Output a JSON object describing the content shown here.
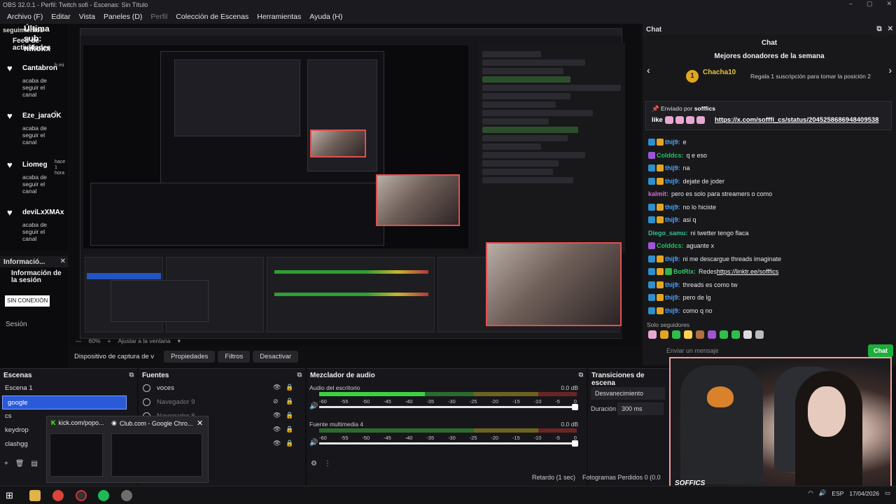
{
  "window": {
    "title": "OBS 32.0.1 - Perfil: Twitch sofi - Escenas: Sin Título"
  },
  "menu": [
    "Archivo (F)",
    "Editar",
    "Vista",
    "Paneles (D)",
    "Perfil",
    "Colección de Escenas",
    "Herramientas",
    "Ayuda (H)"
  ],
  "feed": {
    "ultima_sub": "Última sub: nikoxx",
    "seguimientos": "seguimientos",
    "title": "Feed de actividades",
    "items": [
      {
        "name": "Cantabron",
        "time": "h mi",
        "desc": "acaba de seguir el canal"
      },
      {
        "name": "Eze_jaraOK",
        "time": "h",
        "desc": "acaba de seguir el canal"
      },
      {
        "name": "Liomeg",
        "time": "hace 1 hora",
        "desc": "acaba de seguir el canal"
      },
      {
        "name": "deviLxXMAx",
        "time": "",
        "desc": "acaba de seguir el canal"
      }
    ]
  },
  "info": {
    "header": "Informació...",
    "title": "Información de la sesión",
    "status": "SIN CONEXIÓN",
    "session": "Sesión"
  },
  "zoom": {
    "percent": "60%",
    "fit": "Ajustar a la ventana"
  },
  "controls": {
    "source": "Dispositivo de captura de v",
    "properties": "Propiedades",
    "filters": "Filtros",
    "deactivate": "Desactivar"
  },
  "scenes": {
    "title": "Escenas",
    "items": [
      "Escena 1",
      "google",
      "cs",
      "keydrop",
      "clashgg"
    ],
    "active_index": 1
  },
  "sources": {
    "title": "Fuentes",
    "items": [
      {
        "name": "voces",
        "dim": false
      },
      {
        "name": "Navegador 9",
        "dim": true
      },
      {
        "name": "Navegador 8",
        "dim": true
      },
      {
        "name": "",
        "dim": false
      },
      {
        "name": "",
        "dim": false
      }
    ]
  },
  "mixer": {
    "title": "Mezclador de audio",
    "tracks": [
      {
        "name": "Audio del escritorio",
        "db": "0.0 dB",
        "level": 0.41
      },
      {
        "name": "Fuente multimedia 4",
        "db": "0.0 dB",
        "level": 0.0
      }
    ],
    "scale": [
      "-60",
      "-55",
      "-50",
      "-45",
      "-40",
      "-35",
      "-30",
      "-25",
      "-20",
      "-15",
      "-10",
      "-5",
      "0"
    ]
  },
  "transitions": {
    "title": "Transiciones de escena",
    "type": "Desvanecimiento",
    "duration_label": "Duración",
    "duration": "300 ms"
  },
  "status": {
    "delay": "Retardo (1 sec)",
    "dropped": "Fotogramas Perdidos 0 (0.0"
  },
  "popup": {
    "tab1": "kick.com/popo...",
    "tab2": "Club.com - Google Chro..."
  },
  "chat": {
    "dock_title": "Chat",
    "header": "Chat",
    "donors_title": "Mejores donadores de la semana",
    "donor": {
      "rank": "1",
      "name": "Chacha10",
      "note": "Regala 1 suscripción para tomar la posición 2"
    },
    "pinned": {
      "by_label": "Enviado por",
      "by_user": "sofffics",
      "text": "like",
      "link": "https://x.com/sofffi_cs/status/2045258686948409538"
    },
    "messages": [
      {
        "user": "thij9",
        "cls": "u-thij",
        "badges": [
          "b1",
          "b2"
        ],
        "text": "e"
      },
      {
        "user": "Colddcs",
        "cls": "u-cold",
        "badges": [
          "b3"
        ],
        "text": "q e eso"
      },
      {
        "user": "thij9",
        "cls": "u-thij",
        "badges": [
          "b1",
          "b2"
        ],
        "text": "na"
      },
      {
        "user": "thij9",
        "cls": "u-thij",
        "badges": [
          "b1",
          "b2"
        ],
        "text": "dejate de joder"
      },
      {
        "user": "kalmit",
        "cls": "u-kal",
        "badges": [],
        "text": "pero es solo para streamers o como"
      },
      {
        "user": "thij9",
        "cls": "u-thij",
        "badges": [
          "b1",
          "b2"
        ],
        "text": "no lo hiciste"
      },
      {
        "user": "thij9",
        "cls": "u-thij",
        "badges": [
          "b1",
          "b2"
        ],
        "text": "asi q"
      },
      {
        "user": "Diego_samu",
        "cls": "u-dieg",
        "badges": [],
        "text": "ni twetter tengo flaca"
      },
      {
        "user": "Colddcs",
        "cls": "u-cold",
        "badges": [
          "b3"
        ],
        "text": "aguante x"
      },
      {
        "user": "thij9",
        "cls": "u-thij",
        "badges": [
          "b1",
          "b2"
        ],
        "text": "ni me descargue threads imaginate"
      },
      {
        "user": "BotRix",
        "cls": "u-bot",
        "badges": [
          "b1",
          "b2",
          "b4"
        ],
        "text": "Redes ",
        "link": "https://linktr.ee/sofffics"
      },
      {
        "user": "thij9",
        "cls": "u-thij",
        "badges": [
          "b1",
          "b2"
        ],
        "text": "threads es como tw"
      },
      {
        "user": "thij9",
        "cls": "u-thij",
        "badges": [
          "b1",
          "b2"
        ],
        "text": "pero de lg"
      },
      {
        "user": "thij9",
        "cls": "u-thij",
        "badges": [
          "b1",
          "b2"
        ],
        "text": "como q no"
      }
    ],
    "followers_only": "Solo seguidores",
    "input_placeholder": "Enviar un mensaje",
    "send": "Chat"
  },
  "cam": {
    "tag": "SOFFICS"
  },
  "taskbar": {
    "lang": "ESP",
    "date": "17/04/2026"
  }
}
